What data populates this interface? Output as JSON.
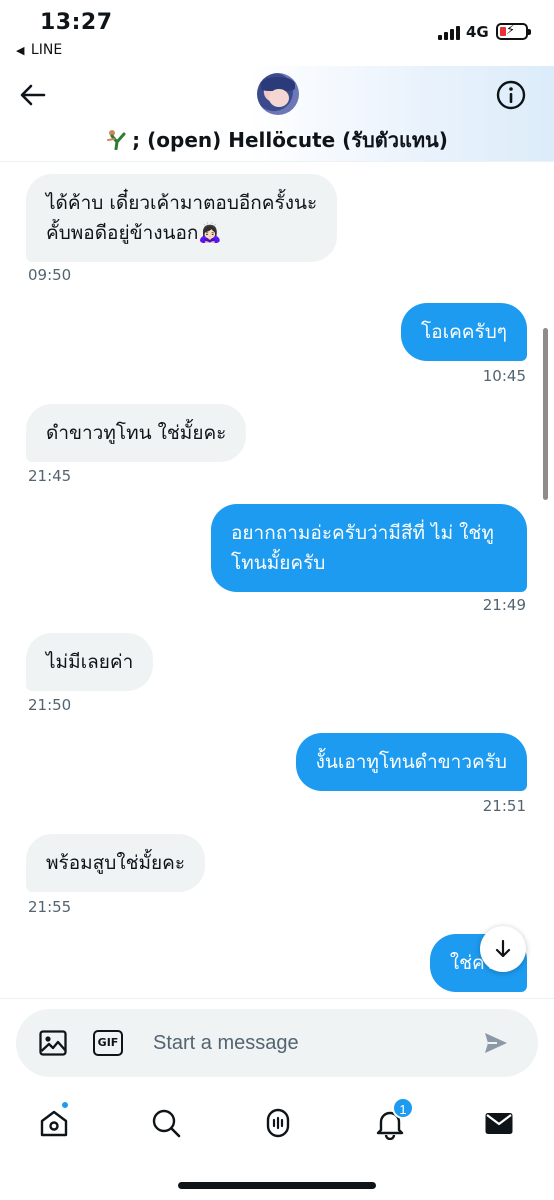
{
  "status_bar": {
    "time": "13:27",
    "back_app": "LINE",
    "network": "4G"
  },
  "header": {
    "title": "; (open) Hellöcute (รับตัวแทน)",
    "back_icon": "arrow-left-icon",
    "info_icon": "info-circle-icon"
  },
  "messages": [
    {
      "direction": "in",
      "text": "ได้ค้าบ เดี๋ยวเค้ามาตอบอีกครั้งนะ\nคั้บพอดีอยู่ข้างนอก🙇🏻‍♀️",
      "time": "09:50"
    },
    {
      "direction": "out",
      "text": "โอเคครับๆ",
      "time": "10:45"
    },
    {
      "direction": "in",
      "text": "ดำขาวทูโทน ใช่มั้ยคะ",
      "time": "21:45"
    },
    {
      "direction": "out",
      "text": "อยากถามอ่ะครับว่ามีสีที่ ไม่ ใช่ทู\nโทนมั้ยครับ",
      "time": "21:49"
    },
    {
      "direction": "in",
      "text": "ไม่มีเลยค่า",
      "time": "21:50"
    },
    {
      "direction": "out",
      "text": "งั้นเอาทูโทนดำขาวครับ",
      "time": "21:51"
    },
    {
      "direction": "in",
      "text": "พร้อมสูบใช่มั้ยคะ",
      "time": "21:55"
    },
    {
      "direction": "out",
      "text": "ใช่ครับ",
      "time": ""
    }
  ],
  "composer": {
    "placeholder": "Start a message",
    "gif_label": "GIF"
  },
  "bottom_nav": {
    "items": [
      "home-icon",
      "search-icon",
      "spaces-icon",
      "notifications-icon",
      "messages-icon"
    ],
    "notification_count": "1"
  },
  "colors": {
    "accent": "#1d9bf0",
    "incoming_bubble": "#eff3f4",
    "text": "#0f1419",
    "muted": "#536471"
  }
}
